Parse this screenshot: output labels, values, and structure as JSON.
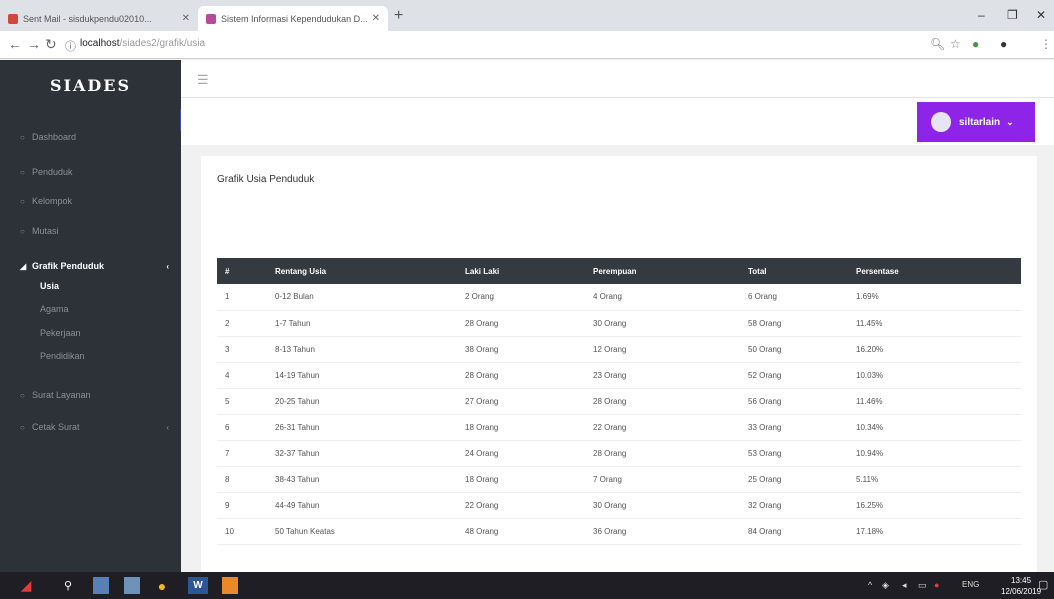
{
  "browser": {
    "tabs": [
      {
        "title": "Sent Mail - sisdukpendu02010...",
        "favicon_color": "#d44638"
      },
      {
        "title": "Sistem Informasi Kependudukan D...",
        "favicon_color": "#b94a9a"
      }
    ],
    "new_tab": "+",
    "url_host": "localhost",
    "url_path": "/siades2/grafik/usia",
    "window_controls": [
      "–",
      "❐",
      "✕"
    ],
    "nav_icons": [
      "back-icon",
      "forward-icon",
      "reload-icon",
      "info-icon"
    ]
  },
  "sidebar": {
    "brand": "SIADES",
    "items": [
      {
        "label": "Dashboard",
        "icon": "circle-icon"
      },
      {
        "label": "Penduduk",
        "icon": "circle-icon"
      },
      {
        "label": "Kelompok",
        "icon": "circle-icon"
      },
      {
        "label": "Mutasi",
        "icon": "circle-icon"
      },
      {
        "label": "Grafik Penduduk",
        "icon": "chart-icon",
        "active": true,
        "caret": "‹"
      },
      {
        "label": "Surat Layanan",
        "icon": "circle-icon"
      },
      {
        "label": "Cetak Surat",
        "icon": "circle-icon",
        "caret": "‹"
      }
    ],
    "sub_items": [
      {
        "label": "Usia",
        "current": true
      },
      {
        "label": "Agama"
      },
      {
        "label": "Pekerjaan"
      },
      {
        "label": "Pendidikan"
      }
    ]
  },
  "header": {
    "menu_icon": "hamburger-icon",
    "user_label": "siltarlain",
    "user_caret": "⌄"
  },
  "card": {
    "title": "Grafik Usia Penduduk"
  },
  "table": {
    "headers": [
      "#",
      "Rentang Usia",
      "Laki Laki",
      "Perempuan",
      "Total",
      "Persentase"
    ],
    "rows": [
      [
        "1",
        "0-12 Bulan",
        "2 Orang",
        "4 Orang",
        "6 Orang",
        "1.69%"
      ],
      [
        "2",
        "1-7 Tahun",
        "28 Orang",
        "30 Orang",
        "58 Orang",
        "11.45%"
      ],
      [
        "3",
        "8-13 Tahun",
        "38 Orang",
        "12 Orang",
        "50 Orang",
        "16.20%"
      ],
      [
        "4",
        "14-19 Tahun",
        "28 Orang",
        "23 Orang",
        "52 Orang",
        "10.03%"
      ],
      [
        "5",
        "20-25 Tahun",
        "27 Orang",
        "28 Orang",
        "56 Orang",
        "11.46%"
      ],
      [
        "6",
        "26-31 Tahun",
        "18 Orang",
        "22 Orang",
        "33 Orang",
        "10.34%"
      ],
      [
        "7",
        "32-37 Tahun",
        "24 Orang",
        "28 Orang",
        "53 Orang",
        "10.94%"
      ],
      [
        "8",
        "38-43 Tahun",
        "18 Orang",
        "7 Orang",
        "25 Orang",
        "5.11%"
      ],
      [
        "9",
        "44-49 Tahun",
        "22 Orang",
        "30 Orang",
        "32 Orang",
        "16.25%"
      ],
      [
        "10",
        "50 Tahun Keatas",
        "48 Orang",
        "36 Orang",
        "84 Orang",
        "17.18%"
      ]
    ]
  },
  "taskbar": {
    "lang": "ENG",
    "time": "13:45",
    "date": "12/06/2019"
  }
}
